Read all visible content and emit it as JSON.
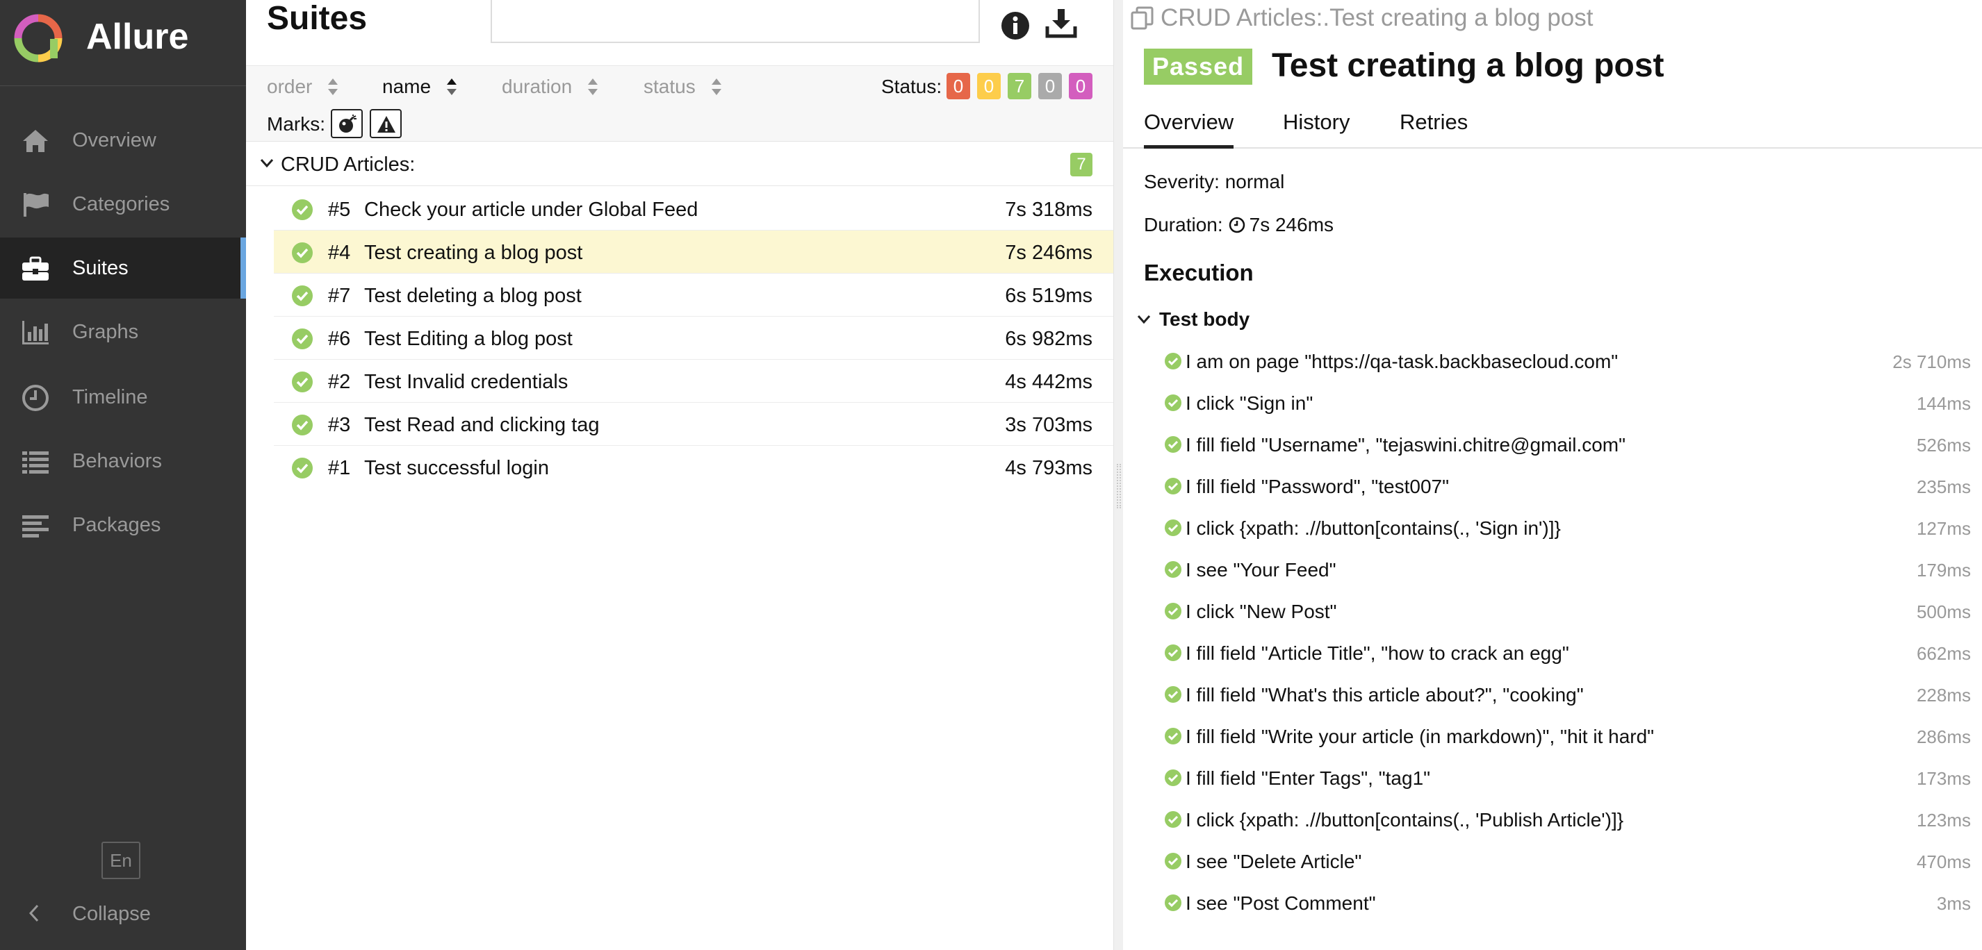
{
  "brand": {
    "title": "Allure"
  },
  "colors": {
    "sidebar_bg": "#343434",
    "passed": "#97cc64",
    "failed": "#e66749",
    "broken": "#fdcd4b",
    "skipped": "#aaaaaa",
    "unknown": "#d35ebe",
    "selected_row": "#fcf7d2",
    "accent": "#6aa6e0"
  },
  "sidebar": {
    "items": [
      {
        "label": "Overview",
        "icon": "home-icon"
      },
      {
        "label": "Categories",
        "icon": "flag-icon"
      },
      {
        "label": "Suites",
        "icon": "briefcase-icon",
        "active": true
      },
      {
        "label": "Graphs",
        "icon": "bar-chart-icon"
      },
      {
        "label": "Timeline",
        "icon": "clock-icon"
      },
      {
        "label": "Behaviors",
        "icon": "list-icon"
      },
      {
        "label": "Packages",
        "icon": "align-left-icon"
      }
    ],
    "language": "En",
    "collapse_label": "Collapse"
  },
  "suites": {
    "title": "Suites",
    "search_value": "",
    "sorters": [
      "order",
      "name",
      "duration",
      "status"
    ],
    "active_sorter": "name",
    "status_label": "Status:",
    "status_counts": [
      {
        "status": "failed",
        "count": "0"
      },
      {
        "status": "broken",
        "count": "0"
      },
      {
        "status": "passed",
        "count": "7"
      },
      {
        "status": "skipped",
        "count": "0"
      },
      {
        "status": "unknown",
        "count": "0"
      }
    ],
    "marks_label": "Marks:",
    "group": {
      "name": "CRUD Articles:",
      "count": "7"
    },
    "rows": [
      {
        "num": "#5",
        "name": "Check your article under Global Feed",
        "duration": "7s 318ms"
      },
      {
        "num": "#4",
        "name": "Test creating a blog post",
        "duration": "7s 246ms",
        "selected": true
      },
      {
        "num": "#7",
        "name": "Test deleting a blog post",
        "duration": "6s 519ms"
      },
      {
        "num": "#6",
        "name": "Test Editing a blog post",
        "duration": "6s 982ms"
      },
      {
        "num": "#2",
        "name": "Test Invalid credentials",
        "duration": "4s 442ms"
      },
      {
        "num": "#3",
        "name": "Test Read and clicking tag",
        "duration": "3s 703ms"
      },
      {
        "num": "#1",
        "name": "Test successful login",
        "duration": "4s 793ms"
      }
    ]
  },
  "detail": {
    "breadcrumb": "CRUD Articles:.Test creating a blog post",
    "status_badge": "Passed",
    "title": "Test creating a blog post",
    "tabs": [
      "Overview",
      "History",
      "Retries"
    ],
    "active_tab": "Overview",
    "severity": "Severity: normal",
    "duration_label": "Duration:",
    "duration_value": "7s 246ms",
    "execution_heading": "Execution",
    "test_body_label": "Test body",
    "steps": [
      {
        "text": "I am on page \"https://qa-task.backbasecloud.com\"",
        "duration": "2s 710ms"
      },
      {
        "text": "I click \"Sign in\"",
        "duration": "144ms"
      },
      {
        "text": "I fill field \"Username\", \"tejaswini.chitre@gmail.com\"",
        "duration": "526ms"
      },
      {
        "text": "I fill field \"Password\", \"test007\"",
        "duration": "235ms"
      },
      {
        "text": "I click {xpath: .//button[contains(., 'Sign in')]}",
        "duration": "127ms"
      },
      {
        "text": "I see \"Your Feed\"",
        "duration": "179ms"
      },
      {
        "text": "I click \"New Post\"",
        "duration": "500ms"
      },
      {
        "text": "I fill field \"Article Title\", \"how to crack an egg\"",
        "duration": "662ms"
      },
      {
        "text": "I fill field \"What's this article about?\", \"cooking\"",
        "duration": "228ms"
      },
      {
        "text": "I fill field \"Write your article (in markdown)\", \"hit it hard\"",
        "duration": "286ms"
      },
      {
        "text": "I fill field \"Enter Tags\", \"tag1\"",
        "duration": "173ms"
      },
      {
        "text": "I click {xpath: .//button[contains(., 'Publish Article')]}",
        "duration": "123ms"
      },
      {
        "text": "I see \"Delete Article\"",
        "duration": "470ms"
      },
      {
        "text": "I see \"Post Comment\"",
        "duration": "3ms"
      }
    ]
  }
}
